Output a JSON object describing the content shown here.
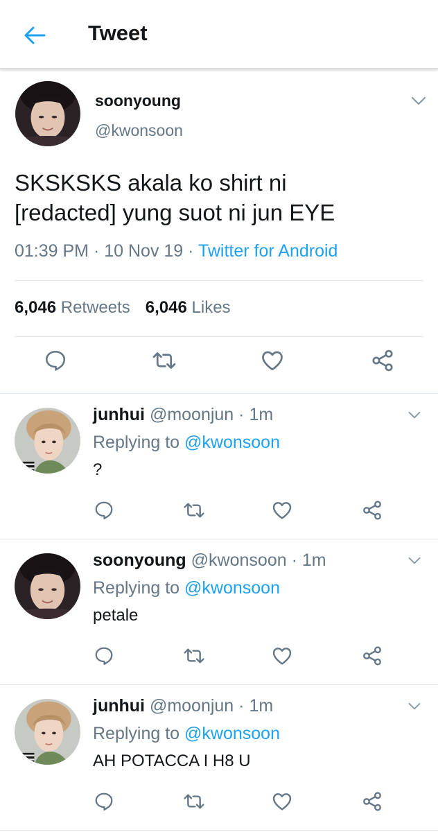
{
  "header": {
    "title": "Tweet",
    "back_icon": "arrow-left-icon",
    "accent": "#1da1f2"
  },
  "main_tweet": {
    "name": "soonyoung",
    "handle": "@kwonsoon",
    "text_line1": "SKSKSKS akala ko shirt ni",
    "text_line2": "[redacted] yung suot ni jun EYE",
    "time": "01:39 PM",
    "sep1": " · ",
    "date": "10 Nov 19",
    "sep2": " · ",
    "source": "Twitter for Android",
    "retweets_count": "6,046",
    "retweets_label": "Retweets",
    "likes_count": "6,046",
    "likes_label": "Likes"
  },
  "replies": [
    {
      "name": "junhui",
      "handle": "@moonjun",
      "time": "· 1m",
      "replying_label": "Replying to",
      "replying_to": "@kwonsoon",
      "text": "?"
    },
    {
      "name": "soonyoung",
      "handle": "@kwonsoon",
      "time": "· 1m",
      "replying_label": "Replying to",
      "replying_to": "@kwonsoon",
      "text": "petale"
    },
    {
      "name": "junhui",
      "handle": "@moonjun",
      "time": "· 1m",
      "replying_label": "Replying to",
      "replying_to": "@kwonsoon",
      "text": "AH POTACCA I H8 U"
    }
  ],
  "icons": {
    "reply": "reply-icon",
    "retweet": "retweet-icon",
    "like": "heart-icon",
    "share": "share-icon",
    "more": "chevron-down-icon"
  },
  "colors": {
    "text": "#14171a",
    "secondary": "#657786",
    "link": "#1da1f2",
    "divider": "#e1e8ed"
  }
}
